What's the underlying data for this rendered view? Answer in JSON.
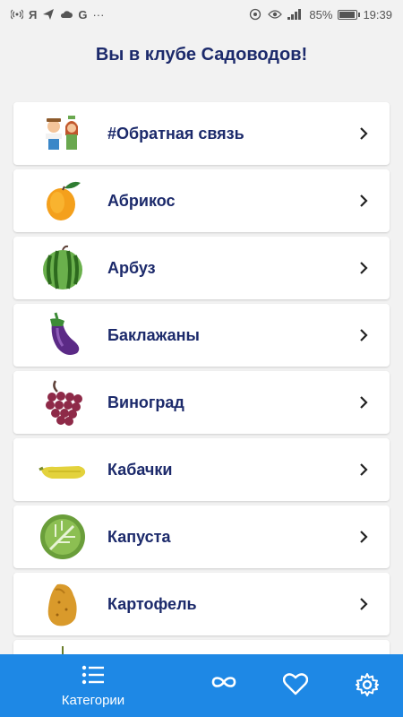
{
  "status": {
    "battery": "85%",
    "time": "19:39",
    "left_icons": [
      "wifi-hotspot-icon",
      "yandex-icon",
      "paper-plane-icon",
      "cloud-icon",
      "google-icon",
      "more-icon"
    ],
    "battery_level": 0.85
  },
  "header": {
    "title": "Вы в клубе Садоводов!"
  },
  "categories": [
    {
      "label": "#Обратная связь",
      "icon": "gardeners-icon"
    },
    {
      "label": "Абрикос",
      "icon": "apricot-icon"
    },
    {
      "label": "Арбуз",
      "icon": "watermelon-icon"
    },
    {
      "label": "Баклажаны",
      "icon": "eggplant-icon"
    },
    {
      "label": "Виноград",
      "icon": "grapes-icon"
    },
    {
      "label": "Кабачки",
      "icon": "zucchini-icon"
    },
    {
      "label": "Капуста",
      "icon": "cabbage-icon"
    },
    {
      "label": "Картофель",
      "icon": "potato-icon"
    }
  ],
  "bottom_nav": {
    "categories_label": "Категории",
    "items": [
      "list-icon",
      "infinity-icon",
      "heart-icon",
      "gear-icon"
    ]
  },
  "colors": {
    "accent": "#1e88e5",
    "title": "#1c2a6b",
    "background": "#f2f2f2"
  }
}
